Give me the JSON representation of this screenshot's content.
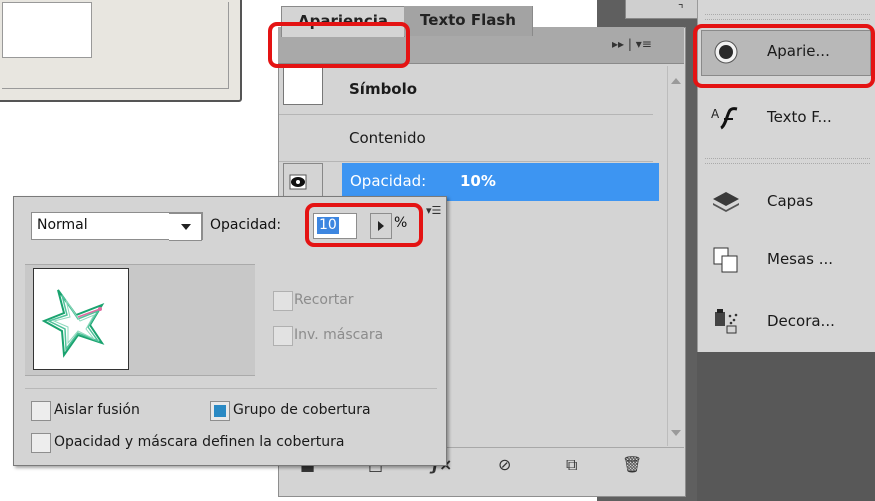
{
  "appearance_panel": {
    "tabs": [
      {
        "label": "Apariencia",
        "active": true
      },
      {
        "label": "Texto Flash",
        "active": false
      }
    ],
    "tab_menu_glyphs": "▸▸ | ▾≡",
    "rows": [
      {
        "label": "Símbolo",
        "bold": true
      },
      {
        "label": "Contenido",
        "bold": false
      }
    ],
    "selected_row": {
      "label": "Opacidad:",
      "value": "10%"
    }
  },
  "transparency_popup": {
    "blend_mode": "Normal",
    "opacity_label": "Opacidad:",
    "opacity_value": "10",
    "opacity_unit": "%",
    "mask_options": [
      {
        "label": "Recortar",
        "enabled": false,
        "checked": false
      },
      {
        "label": "Inv. máscara",
        "enabled": false,
        "checked": false
      }
    ],
    "options": [
      {
        "label": "Aislar fusión",
        "checked": false
      },
      {
        "label": "Grupo de cobertura",
        "checked": true
      },
      {
        "label": "Opacidad y máscara definen la cobertura",
        "checked": false
      }
    ]
  },
  "dock": {
    "items": [
      {
        "label": "Aparie...",
        "icon": "appearance-circle-icon",
        "active": true
      },
      {
        "label": "Texto F...",
        "icon": "flash-text-icon",
        "active": false
      },
      {
        "label": "Capas",
        "icon": "layers-icon",
        "active": false
      },
      {
        "label": "Mesas ...",
        "icon": "artboards-icon",
        "active": false
      },
      {
        "label": "Decora...",
        "icon": "symbol-sprayer-icon",
        "active": false
      }
    ]
  },
  "colors": {
    "selection_blue": "#3d95f2",
    "callout_red": "#e41313",
    "panel_gray": "#d4d4d4",
    "dark_bg": "#585858"
  }
}
